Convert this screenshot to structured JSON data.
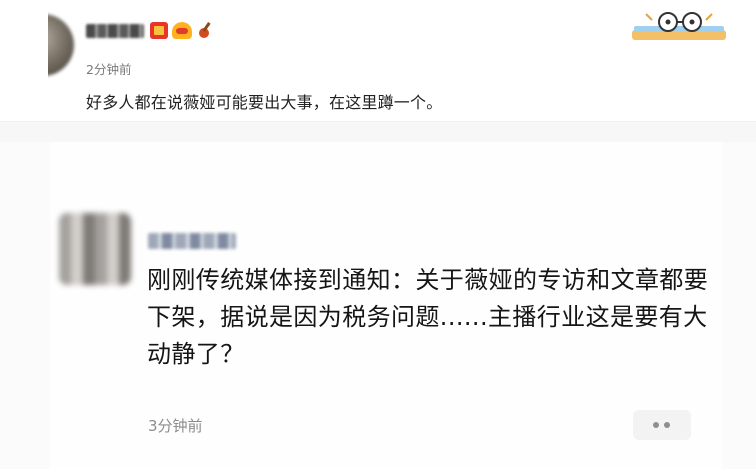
{
  "post": {
    "username": "",
    "time": "2分钟前",
    "content": "好多人都在说薇娅可能要出大事，在这里蹲一个。",
    "badges": [
      "red-envelope-badge",
      "fire-hat-badge",
      "guitar-badge"
    ],
    "sticker": "glasses-sticker"
  },
  "screenshot": {
    "username": "",
    "content": "刚刚传统媒体接到通知：关于薇娅的专访和文章都要下架，据说是因为税务问题......主播行业这是要有大动静了？",
    "time": "3分钟前",
    "more_label": "••"
  },
  "colors": {
    "time": "#7a7a7a",
    "text": "#222222",
    "card_bg": "#fbfbfb",
    "button_bg": "#f3f3f3"
  }
}
